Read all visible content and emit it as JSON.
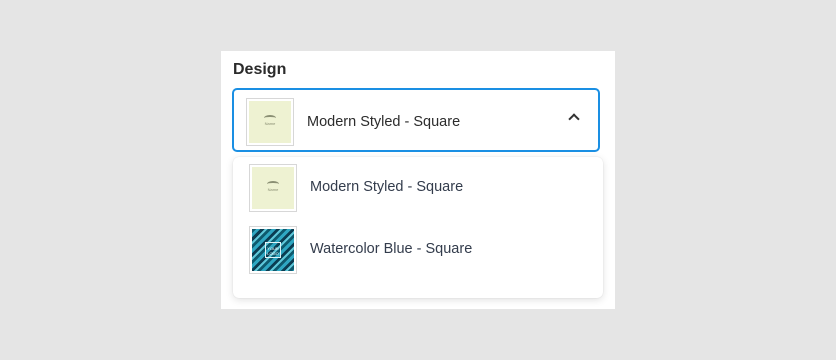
{
  "field": {
    "label": "Design"
  },
  "select": {
    "selected_label": "Modern Styled - Square",
    "thumbnail_text": "Name",
    "expanded": true,
    "border_color": "#1a8fe3"
  },
  "options": [
    {
      "label": "Modern Styled - Square",
      "thumbnail_text": "Name"
    },
    {
      "label": "Watercolor Blue - Square",
      "thumbnail_text": "YOUR LOGO"
    }
  ],
  "icons": {
    "toggle": "chevron-up-icon"
  }
}
